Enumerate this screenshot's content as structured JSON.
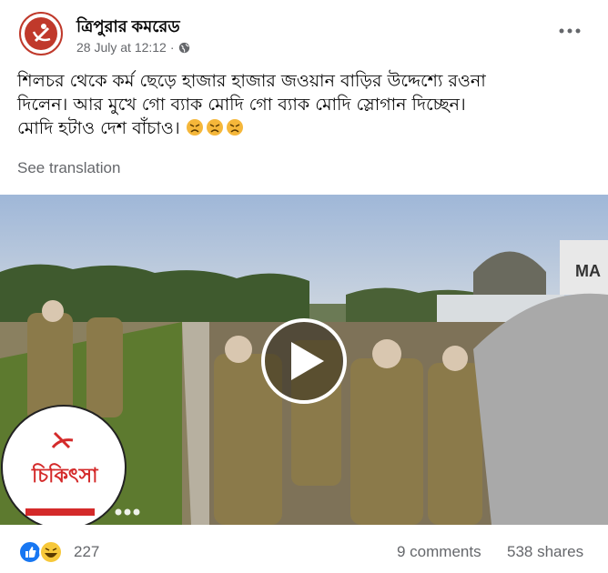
{
  "post": {
    "page_name": "ত্রিপুরার কমরেড",
    "timestamp": "28 July at 12:12",
    "visibility_icon": "globe-icon",
    "text_line1": "শিলচর থেকে কর্ম ছেড়ে হাজার হাজার জওয়ান বাড়ির উদ্দেশ্যে রওনা",
    "text_line2": "দিলেন। আর মুখে গো ব্যাক মোদি গো ব্যাক মোদি স্লোগান দিচ্ছেন।",
    "text_line3": "মোদি হটাও দেশ বাঁচাও।",
    "emojis": [
      "angry-face-emoji",
      "angry-face-emoji",
      "angry-face-emoji"
    ],
    "see_translation": "See translation"
  },
  "video": {
    "watermark_text": "চিকিৎসা",
    "building_sign": "MA",
    "play_icon": "play-icon"
  },
  "footer": {
    "reactions": [
      "like-icon",
      "haha-icon"
    ],
    "reaction_count": "227",
    "comments": "9 comments",
    "shares": "538 shares"
  },
  "colors": {
    "brand_red": "#c0392b",
    "like_blue": "#1877f2",
    "text_secondary": "#65676b"
  }
}
